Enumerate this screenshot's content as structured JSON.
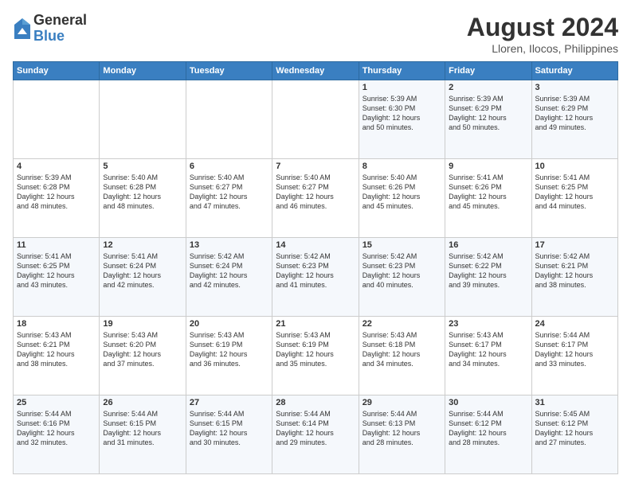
{
  "logo": {
    "general": "General",
    "blue": "Blue"
  },
  "title": {
    "month_year": "August 2024",
    "location": "Lloren, Ilocos, Philippines"
  },
  "headers": [
    "Sunday",
    "Monday",
    "Tuesday",
    "Wednesday",
    "Thursday",
    "Friday",
    "Saturday"
  ],
  "weeks": [
    [
      {
        "day": "",
        "info": ""
      },
      {
        "day": "",
        "info": ""
      },
      {
        "day": "",
        "info": ""
      },
      {
        "day": "",
        "info": ""
      },
      {
        "day": "1",
        "info": "Sunrise: 5:39 AM\nSunset: 6:30 PM\nDaylight: 12 hours\nand 50 minutes."
      },
      {
        "day": "2",
        "info": "Sunrise: 5:39 AM\nSunset: 6:29 PM\nDaylight: 12 hours\nand 50 minutes."
      },
      {
        "day": "3",
        "info": "Sunrise: 5:39 AM\nSunset: 6:29 PM\nDaylight: 12 hours\nand 49 minutes."
      }
    ],
    [
      {
        "day": "4",
        "info": "Sunrise: 5:39 AM\nSunset: 6:28 PM\nDaylight: 12 hours\nand 48 minutes."
      },
      {
        "day": "5",
        "info": "Sunrise: 5:40 AM\nSunset: 6:28 PM\nDaylight: 12 hours\nand 48 minutes."
      },
      {
        "day": "6",
        "info": "Sunrise: 5:40 AM\nSunset: 6:27 PM\nDaylight: 12 hours\nand 47 minutes."
      },
      {
        "day": "7",
        "info": "Sunrise: 5:40 AM\nSunset: 6:27 PM\nDaylight: 12 hours\nand 46 minutes."
      },
      {
        "day": "8",
        "info": "Sunrise: 5:40 AM\nSunset: 6:26 PM\nDaylight: 12 hours\nand 45 minutes."
      },
      {
        "day": "9",
        "info": "Sunrise: 5:41 AM\nSunset: 6:26 PM\nDaylight: 12 hours\nand 45 minutes."
      },
      {
        "day": "10",
        "info": "Sunrise: 5:41 AM\nSunset: 6:25 PM\nDaylight: 12 hours\nand 44 minutes."
      }
    ],
    [
      {
        "day": "11",
        "info": "Sunrise: 5:41 AM\nSunset: 6:25 PM\nDaylight: 12 hours\nand 43 minutes."
      },
      {
        "day": "12",
        "info": "Sunrise: 5:41 AM\nSunset: 6:24 PM\nDaylight: 12 hours\nand 42 minutes."
      },
      {
        "day": "13",
        "info": "Sunrise: 5:42 AM\nSunset: 6:24 PM\nDaylight: 12 hours\nand 42 minutes."
      },
      {
        "day": "14",
        "info": "Sunrise: 5:42 AM\nSunset: 6:23 PM\nDaylight: 12 hours\nand 41 minutes."
      },
      {
        "day": "15",
        "info": "Sunrise: 5:42 AM\nSunset: 6:23 PM\nDaylight: 12 hours\nand 40 minutes."
      },
      {
        "day": "16",
        "info": "Sunrise: 5:42 AM\nSunset: 6:22 PM\nDaylight: 12 hours\nand 39 minutes."
      },
      {
        "day": "17",
        "info": "Sunrise: 5:42 AM\nSunset: 6:21 PM\nDaylight: 12 hours\nand 38 minutes."
      }
    ],
    [
      {
        "day": "18",
        "info": "Sunrise: 5:43 AM\nSunset: 6:21 PM\nDaylight: 12 hours\nand 38 minutes."
      },
      {
        "day": "19",
        "info": "Sunrise: 5:43 AM\nSunset: 6:20 PM\nDaylight: 12 hours\nand 37 minutes."
      },
      {
        "day": "20",
        "info": "Sunrise: 5:43 AM\nSunset: 6:19 PM\nDaylight: 12 hours\nand 36 minutes."
      },
      {
        "day": "21",
        "info": "Sunrise: 5:43 AM\nSunset: 6:19 PM\nDaylight: 12 hours\nand 35 minutes."
      },
      {
        "day": "22",
        "info": "Sunrise: 5:43 AM\nSunset: 6:18 PM\nDaylight: 12 hours\nand 34 minutes."
      },
      {
        "day": "23",
        "info": "Sunrise: 5:43 AM\nSunset: 6:17 PM\nDaylight: 12 hours\nand 34 minutes."
      },
      {
        "day": "24",
        "info": "Sunrise: 5:44 AM\nSunset: 6:17 PM\nDaylight: 12 hours\nand 33 minutes."
      }
    ],
    [
      {
        "day": "25",
        "info": "Sunrise: 5:44 AM\nSunset: 6:16 PM\nDaylight: 12 hours\nand 32 minutes."
      },
      {
        "day": "26",
        "info": "Sunrise: 5:44 AM\nSunset: 6:15 PM\nDaylight: 12 hours\nand 31 minutes."
      },
      {
        "day": "27",
        "info": "Sunrise: 5:44 AM\nSunset: 6:15 PM\nDaylight: 12 hours\nand 30 minutes."
      },
      {
        "day": "28",
        "info": "Sunrise: 5:44 AM\nSunset: 6:14 PM\nDaylight: 12 hours\nand 29 minutes."
      },
      {
        "day": "29",
        "info": "Sunrise: 5:44 AM\nSunset: 6:13 PM\nDaylight: 12 hours\nand 28 minutes."
      },
      {
        "day": "30",
        "info": "Sunrise: 5:44 AM\nSunset: 6:12 PM\nDaylight: 12 hours\nand 28 minutes."
      },
      {
        "day": "31",
        "info": "Sunrise: 5:45 AM\nSunset: 6:12 PM\nDaylight: 12 hours\nand 27 minutes."
      }
    ]
  ]
}
